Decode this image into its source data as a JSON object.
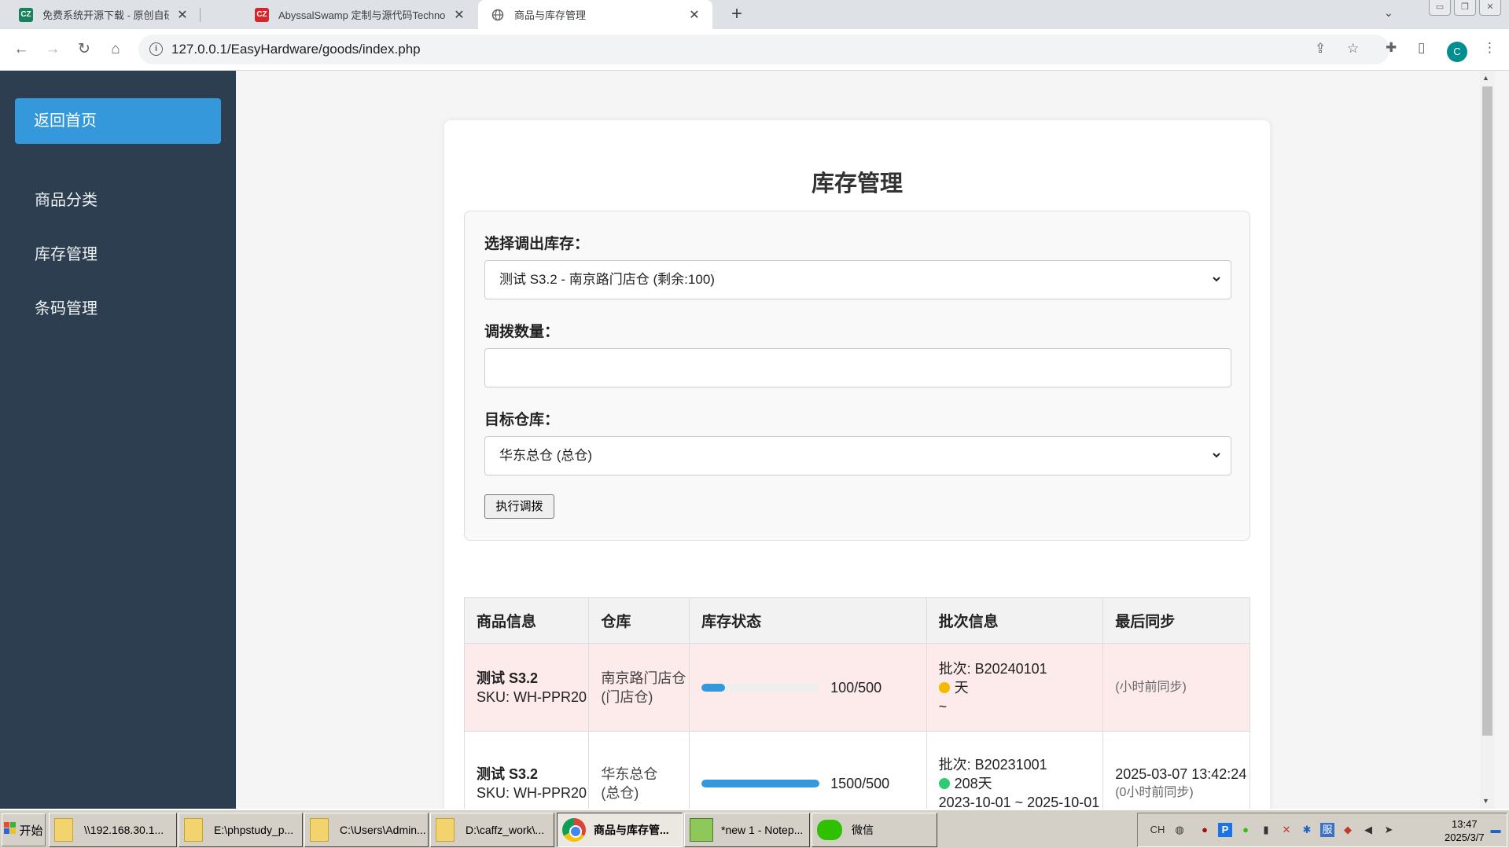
{
  "browser": {
    "tabs": [
      {
        "title": "免费系统开源下载 - 原创自研",
        "favicon": "CZ",
        "active": false
      },
      {
        "title": "AbyssalSwamp 定制与源代码Technol",
        "favicon": "CZ",
        "active": false
      },
      {
        "title": "商品与库存管理",
        "favicon": "globe-icon",
        "active": true
      }
    ],
    "new_tab": "+",
    "url": "127.0.0.1/EasyHardware/goods/index.php",
    "profile_initial": "C"
  },
  "sidebar": {
    "back_button": "返回首页",
    "items": [
      {
        "label": "商品分类"
      },
      {
        "label": "库存管理"
      },
      {
        "label": "条码管理"
      }
    ]
  },
  "page": {
    "title": "库存管理",
    "form": {
      "source_label": "选择调出库存：",
      "source_value": "测试 S3.2 - 南京路门店仓 (剩余:100)",
      "qty_label": "调拨数量：",
      "qty_value": "",
      "target_label": "目标仓库：",
      "target_value": "华东总仓 (总仓)",
      "submit_label": "执行调拨"
    },
    "table": {
      "headers": [
        "商品信息",
        "仓库",
        "库存状态",
        "批次信息",
        "最后同步"
      ],
      "rows": [
        {
          "product": "测试 S3.2",
          "sku": "SKU: WH-PPR20",
          "warehouse_1": "南京路门店仓",
          "warehouse_2": "(门店仓)",
          "stock_text": "100/500",
          "stock_fraction": 0.2,
          "batch": "批次: B20240101",
          "shelf": "天",
          "shelf_status": "yellow",
          "range": "~",
          "sync_time": "",
          "sync_ago": "(小时前同步)"
        },
        {
          "product": "测试 S3.2",
          "sku": "SKU: WH-PPR20",
          "warehouse_1": "华东总仓",
          "warehouse_2": "(总仓)",
          "stock_text": "1500/500",
          "stock_fraction": 1.0,
          "batch": "批次: B20231001",
          "shelf": "208天",
          "shelf_status": "green",
          "range": "2023-10-01 ~ 2025-10-01",
          "sync_time": "2025-03-07 13:42:24",
          "sync_ago": "(0小时前同步)"
        }
      ]
    }
  },
  "taskbar": {
    "start": "开始",
    "buttons": [
      {
        "label": "\\\\192.168.30.1..."
      },
      {
        "label": "E:\\phpstudy_p..."
      },
      {
        "label": "C:\\Users\\Admin..."
      },
      {
        "label": "D:\\caffz_work\\..."
      },
      {
        "label": "商品与库存管..."
      },
      {
        "label": "*new 1 - Notep..."
      },
      {
        "label": "微信"
      }
    ],
    "ime": "CH",
    "time": "13:47",
    "date": "2025/3/7"
  },
  "colors": {
    "sidebar_bg": "#2c3e50",
    "accent": "#3498db",
    "warn_row": "#fdeaea",
    "dot_yellow": "#f5b800",
    "dot_green": "#2ecc71"
  }
}
